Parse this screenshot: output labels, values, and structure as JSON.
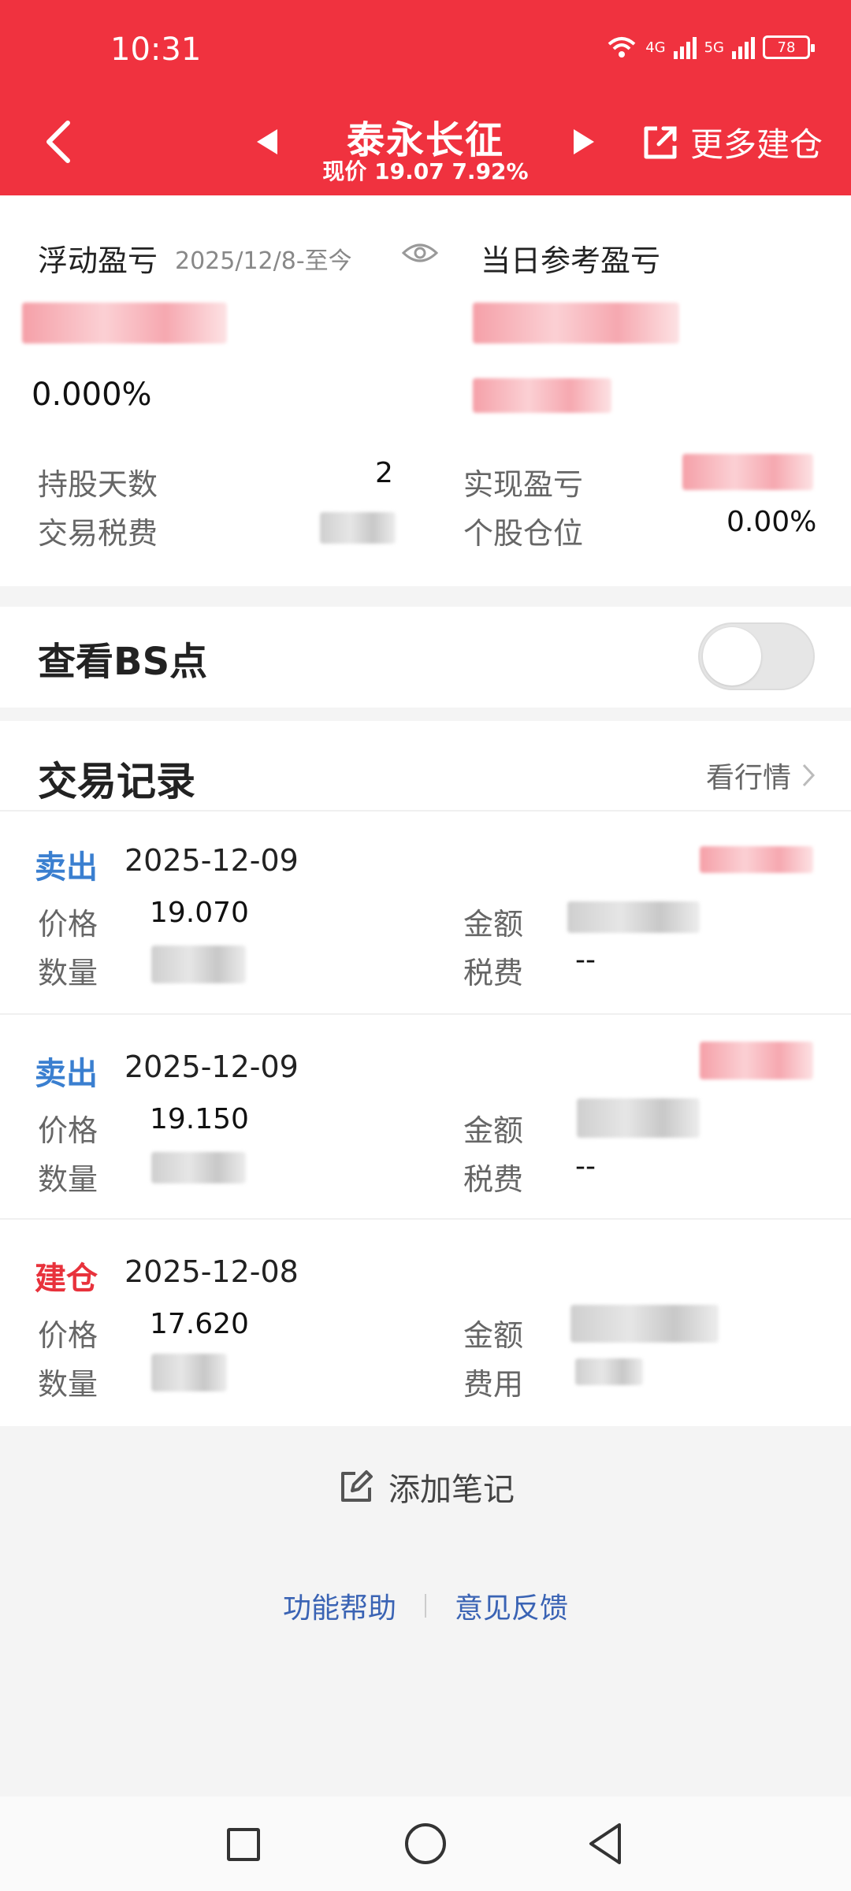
{
  "status": {
    "time": "10:31",
    "net1": "4G",
    "net2": "5G",
    "battery": "78"
  },
  "header": {
    "title": "泰永长征",
    "price_line": "现价 19.07 7.92%",
    "more_label": "更多建仓"
  },
  "pl": {
    "floating_title": "浮动盈亏",
    "floating_date": "2025/12/8-至今",
    "daily_title": "当日参考盈亏",
    "floating_pct": "0.000%",
    "rows": [
      {
        "label": "持股天数",
        "value": "2"
      },
      {
        "label": "交易税费",
        "value": ""
      },
      {
        "label": "实现盈亏",
        "value": ""
      },
      {
        "label": "个股仓位",
        "value": "0.00%"
      }
    ]
  },
  "bs": {
    "title": "查看BS点",
    "enabled": false
  },
  "trades": {
    "title": "交易记录",
    "market_link": "看行情",
    "labels": {
      "price": "价格",
      "qty": "数量",
      "amount": "金额",
      "tax": "税费",
      "fee": "费用"
    },
    "items": [
      {
        "type": "卖出",
        "date": "2025-12-09",
        "price": "19.070",
        "tax": "--"
      },
      {
        "type": "卖出",
        "date": "2025-12-09",
        "price": "19.150",
        "tax": "--"
      },
      {
        "type": "建仓",
        "date": "2025-12-08",
        "price": "17.620",
        "tax": ""
      }
    ]
  },
  "note_button": "添加笔记",
  "footer": {
    "help": "功能帮助",
    "feedback": "意见反馈"
  },
  "colors": {
    "brand": "#f0323f",
    "sell": "#3a7fd0",
    "buy": "#e8323c",
    "link": "#3a63b4"
  }
}
